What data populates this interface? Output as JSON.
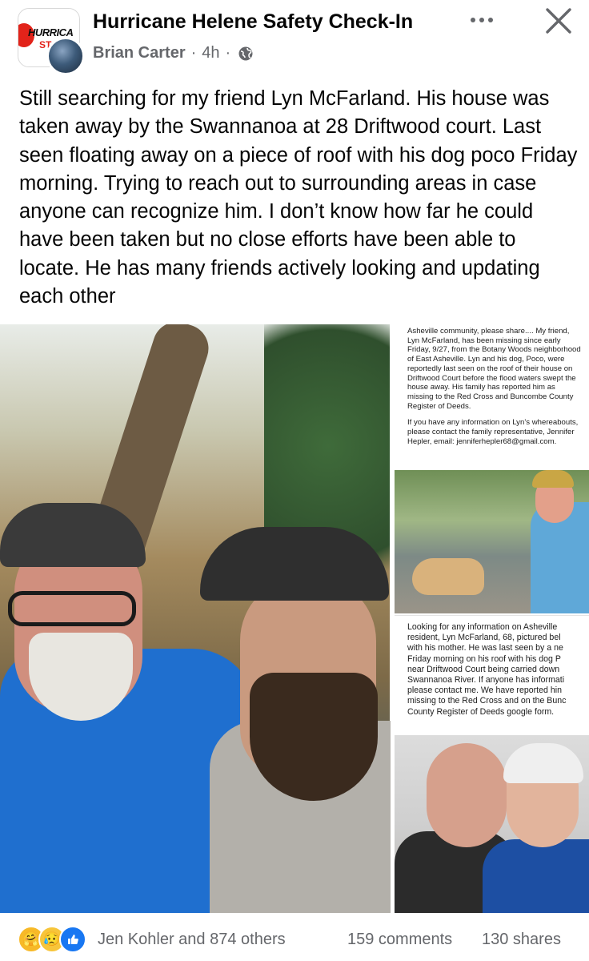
{
  "header": {
    "group_name": "Hurricane Helene Safety Check-In",
    "group_logo_text": "HURRICA",
    "group_logo_text2": "ST",
    "author": "Brian Carter",
    "time": "4h",
    "separator": "·",
    "more_icon": "more-horizontal-icon",
    "close_icon": "close-icon",
    "privacy_icon": "globe-icon"
  },
  "post": {
    "text": "Still searching for my friend Lyn McFarland. His house was taken away by the Swannanoa at 28 Driftwood court. Last seen floating away on a piece of roof with his dog poco Friday morning. Trying to reach out to surrounding areas in case anyone can recognize him. I don’t know how far he could have been taken but no close efforts have been able to locate. He has many friends actively looking and updating each other"
  },
  "images": {
    "card1_p1": "Asheville community, please share.... My friend, Lyn McFarland, has been missing since early Friday, 9/27, from the Botany Woods neighborhood of East Asheville. Lyn and his dog, Poco, were reportedly last seen on the roof of their house on Driftwood Court before the flood waters swept the house away. His family has reported him as missing to the Red Cross and Buncombe County Register of Deeds.",
    "card1_p2": "If you have any information on Lyn’s whereabouts, please contact the family representative, Jennifer Hepler, email: jenniferhepler68@gmail.com.",
    "card2_lines": [
      "Looking for any information on Asheville",
      "resident, Lyn McFarland, 68, pictured bel",
      "with his mother. He was last seen by a ne",
      "Friday morning on his roof with his dog P",
      "near Driftwood Court being carried down",
      "Swannanoa River. If anyone has informati",
      "please contact me. We have reported hin",
      "missing to the Red Cross and on the Bunc",
      "County Register of Deeds google form."
    ]
  },
  "footer": {
    "reaction_icons": [
      "care-icon",
      "sad-icon",
      "like-icon"
    ],
    "reaction_names": "Jen Kohler and 874 others",
    "comments": "159 comments",
    "shares": "130 shares"
  },
  "colors": {
    "text": "#050505",
    "secondary": "#65676b",
    "like_blue": "#1877f2",
    "shirt_blue": "#1f6fcf"
  }
}
